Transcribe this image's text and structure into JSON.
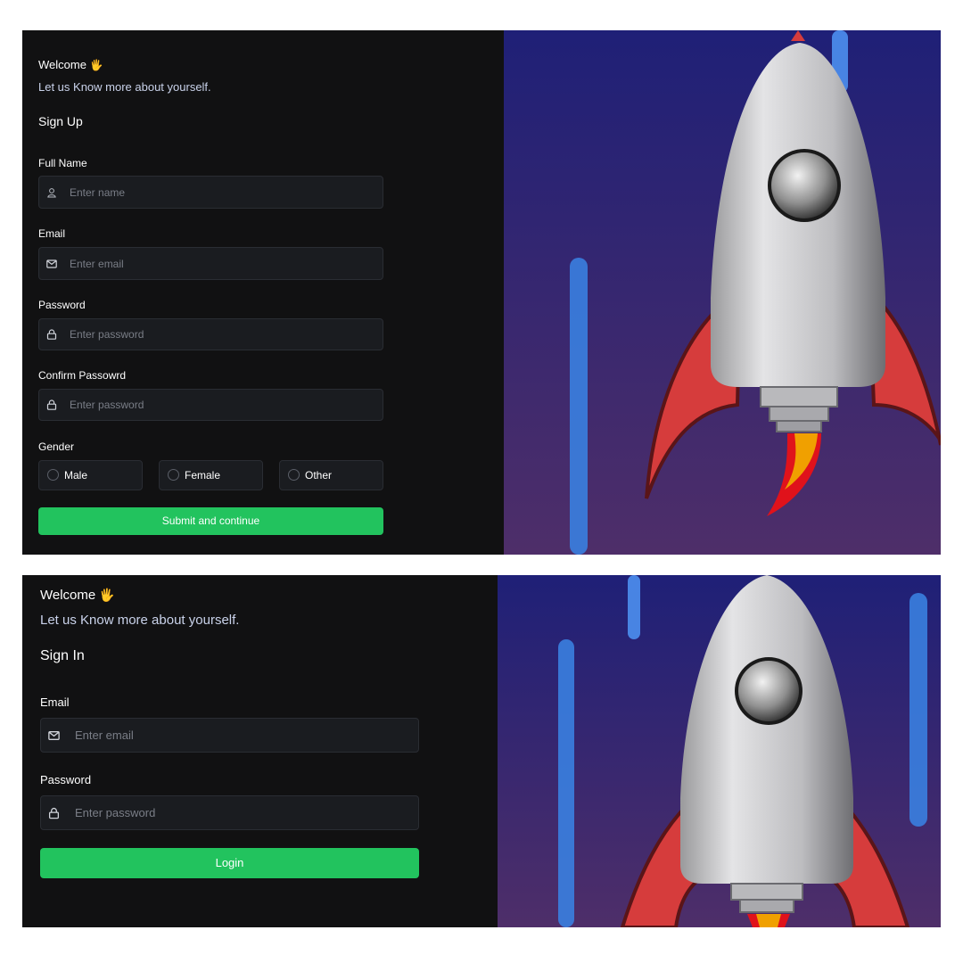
{
  "signup": {
    "welcome": "Welcome",
    "wave_emoji": "🖐",
    "subtitle": "Let us Know more about yourself.",
    "heading": "Sign Up",
    "full_name": {
      "label": "Full Name",
      "placeholder": "Enter name",
      "icon": "user-icon"
    },
    "email": {
      "label": "Email",
      "placeholder": "Enter email",
      "icon": "mail-icon"
    },
    "password": {
      "label": "Password",
      "placeholder": "Enter password",
      "icon": "lock-icon"
    },
    "confirm_password": {
      "label": "Confirm Passowrd",
      "placeholder": "Enter password",
      "icon": "lock-icon"
    },
    "gender": {
      "label": "Gender",
      "options": [
        "Male",
        "Female",
        "Other"
      ]
    },
    "submit_label": "Submit and continue"
  },
  "signin": {
    "welcome": "Welcome",
    "wave_emoji": "🖐",
    "subtitle": "Let us Know more about yourself.",
    "heading": "Sign In",
    "email": {
      "label": "Email",
      "placeholder": "Enter email",
      "icon": "mail-icon"
    },
    "password": {
      "label": "Password",
      "placeholder": "Enter password",
      "icon": "lock-icon"
    },
    "submit_label": "Login"
  },
  "colors": {
    "panel_bg": "#111112",
    "input_bg": "#1a1c20",
    "button_green": "#22c35e",
    "art_bg_top": "#1f2077",
    "art_bg_bottom": "#4e2e69",
    "rocket_fin_red": "#d63c3c",
    "flame_orange": "#f0a000"
  }
}
